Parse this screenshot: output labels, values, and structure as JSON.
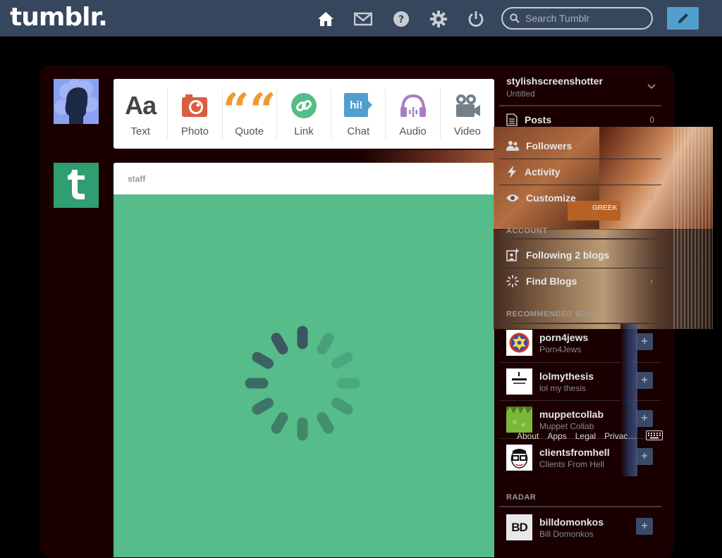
{
  "header": {
    "logo": "tumblr.",
    "search_placeholder": "Search Tumblr",
    "nav": [
      "home-icon",
      "inbox-icon",
      "help-icon",
      "settings-icon",
      "logout-icon"
    ],
    "compose": "pencil-icon"
  },
  "post_types": [
    {
      "label": "Text",
      "icon_text": "Aa",
      "color": "#444444"
    },
    {
      "label": "Photo",
      "icon": "camera-icon",
      "color": "#d95e40"
    },
    {
      "label": "Quote",
      "icon_text": "““",
      "color": "#f2992e"
    },
    {
      "label": "Link",
      "icon": "link-icon",
      "color": "#56bc8a"
    },
    {
      "label": "Chat",
      "icon_text": "hi!",
      "color": "#529ecc"
    },
    {
      "label": "Audio",
      "icon": "headphones-icon",
      "color": "#a77dc2"
    },
    {
      "label": "Video",
      "icon": "video-camera-icon",
      "color": "#748089"
    }
  ],
  "post": {
    "author": "staff",
    "background": "#56bc8a"
  },
  "sidebar": {
    "blog_name": "stylishscreenshotter",
    "blog_title": "Untitled",
    "menu": [
      {
        "label": "Posts",
        "count": "0"
      },
      {
        "label": "Followers"
      },
      {
        "label": "Activity"
      },
      {
        "label": "Customize",
        "arrow": "›"
      }
    ],
    "account_heading": "ACCOUNT",
    "account": [
      {
        "label": "Following 2 blogs"
      },
      {
        "label": "Find Blogs",
        "arrow": "›"
      }
    ],
    "recommended_heading": "RECOMMENDED BLOGS",
    "recommended": [
      {
        "name": "porn4jews",
        "title": "Porn4Jews"
      },
      {
        "name": "lolmythesis",
        "title": "lol my thesis"
      },
      {
        "name": "muppetcollab",
        "title": "Muppet Collab"
      },
      {
        "name": "clientsfromhell",
        "title": "Clients From Hell"
      }
    ],
    "radar_heading": "RADAR",
    "radar": [
      {
        "name": "billdomonkos",
        "title": "Bill Domonkos",
        "avatar_text": "BD"
      }
    ],
    "add_label": "+"
  },
  "footer": [
    "About",
    "Apps",
    "Legal",
    "Privac…"
  ],
  "overlay_text": "GREEK"
}
